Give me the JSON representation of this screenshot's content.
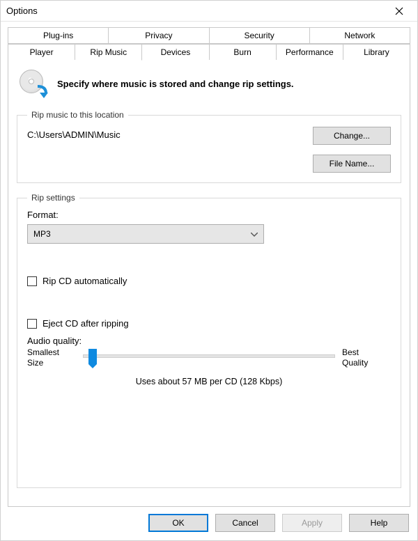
{
  "window": {
    "title": "Options"
  },
  "tabs_top": [
    {
      "label": "Plug-ins"
    },
    {
      "label": "Privacy"
    },
    {
      "label": "Security"
    },
    {
      "label": "Network"
    }
  ],
  "tabs_bottom": [
    {
      "label": "Player"
    },
    {
      "label": "Rip Music",
      "active": true
    },
    {
      "label": "Devices"
    },
    {
      "label": "Burn"
    },
    {
      "label": "Performance"
    },
    {
      "label": "Library"
    }
  ],
  "intro": "Specify where music is stored and change rip settings.",
  "location_group": {
    "legend": "Rip music to this location",
    "path": "C:\\Users\\ADMIN\\Music",
    "change_btn": "Change...",
    "file_name_btn": "File Name..."
  },
  "rip_group": {
    "legend": "Rip settings",
    "format_label": "Format:",
    "format_value": "MP3",
    "rip_auto_label": "Rip CD automatically",
    "rip_auto_checked": false,
    "eject_label": "Eject CD after ripping",
    "eject_checked": false,
    "audio_quality_label": "Audio quality:",
    "slider_left_line1": "Smallest",
    "slider_left_line2": "Size",
    "slider_right_line1": "Best",
    "slider_right_line2": "Quality",
    "slider_caption": "Uses about 57 MB per CD (128 Kbps)"
  },
  "footer": {
    "ok": "OK",
    "cancel": "Cancel",
    "apply": "Apply",
    "help": "Help"
  }
}
